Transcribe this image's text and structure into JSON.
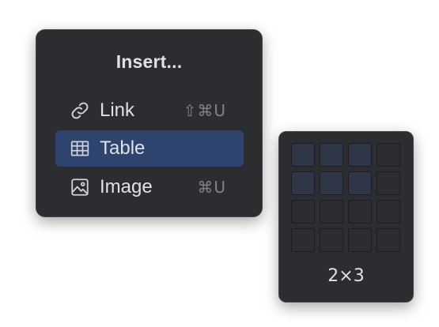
{
  "insert_menu": {
    "title": "Insert...",
    "items": [
      {
        "label": "Link",
        "icon": "link-icon",
        "shortcut": "⇧⌘U",
        "selected": false
      },
      {
        "label": "Table",
        "icon": "table-icon",
        "shortcut": "",
        "selected": true
      },
      {
        "label": "Image",
        "icon": "image-icon",
        "shortcut": "⌘U",
        "selected": false
      }
    ]
  },
  "table_picker": {
    "rows": 4,
    "cols": 4,
    "selected_rows": 2,
    "selected_cols": 3,
    "size_label": "2×3"
  },
  "colors": {
    "menu_background": "#2b2d30",
    "selection": "#2e436e",
    "highlighted_cell": "#2f3648",
    "text": "#dfe1e5",
    "shortcut_text": "#7f838a"
  }
}
